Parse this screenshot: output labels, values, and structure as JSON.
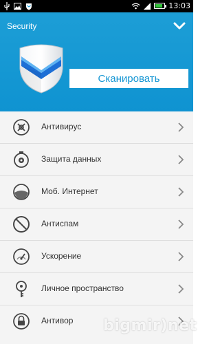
{
  "status_bar": {
    "time": "13:03",
    "battery_percent": 80
  },
  "header": {
    "title": "Security",
    "scan_label": "Сканировать"
  },
  "colors": {
    "accent": "#1596d3",
    "header_bg": "#1d9ed6",
    "list_bg": "#f4f4f4"
  },
  "menu": {
    "items": [
      {
        "label": "Антивирус",
        "icon": "virus-icon"
      },
      {
        "label": "Защита данных",
        "icon": "data-protection-icon"
      },
      {
        "label": "Моб. Интернет",
        "icon": "mobile-internet-icon"
      },
      {
        "label": "Антиспам",
        "icon": "antispam-icon"
      },
      {
        "label": "Ускорение",
        "icon": "speedometer-icon"
      },
      {
        "label": "Личное пространство",
        "icon": "private-space-icon"
      },
      {
        "label": "Антивор",
        "icon": "lock-icon"
      }
    ]
  },
  "watermark": "bigmir)net"
}
